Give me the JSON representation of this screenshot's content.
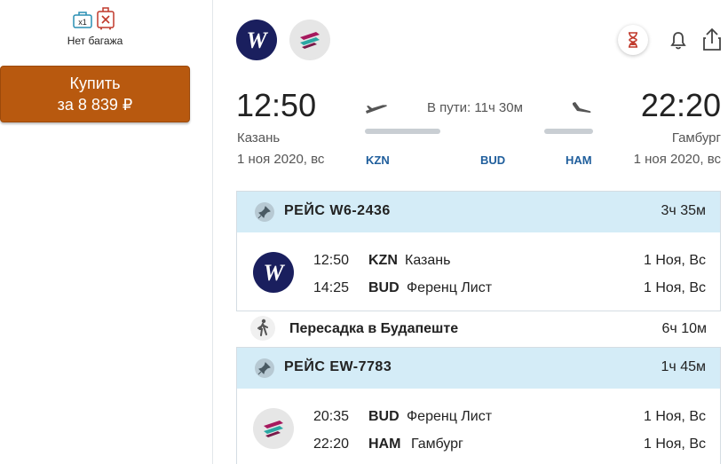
{
  "left": {
    "handbag_badge": "x1",
    "baggage_label": "Нет багажа",
    "buy_button": {
      "line1": "Купить",
      "line2": "за 8 839 ₽"
    }
  },
  "summary": {
    "departure": {
      "time": "12:50",
      "city": "Казань",
      "date": "1 ноя 2020, вс",
      "code": "KZN"
    },
    "arrival": {
      "time": "22:20",
      "city": "Гамбург",
      "date": "1 ноя 2020, вс",
      "code": "HAM"
    },
    "transit_code": "BUD",
    "duration": "В пути: 11ч 30м"
  },
  "segments": [
    {
      "flight": "РЕЙС W6-2436",
      "duration": "3ч 35м",
      "logo": "wizzair-logo",
      "rows": [
        {
          "time": "12:50",
          "code": "KZN",
          "city": "Казань",
          "date": "1 Ноя, Вс"
        },
        {
          "time": "14:25",
          "code": "BUD",
          "city": "Ференц Лист",
          "date": "1 Ноя, Вс"
        }
      ]
    },
    {
      "flight": "РЕЙС EW-7783",
      "duration": "1ч 45м",
      "logo": "eurowings-logo",
      "rows": [
        {
          "time": "20:35",
          "code": "BUD",
          "city": "Ференц Лист",
          "date": "1 Ноя, Вс"
        },
        {
          "time": "22:20",
          "code": "HAM",
          "city": "Гамбург",
          "date": "1 Ноя, Вс"
        }
      ]
    }
  ],
  "transfer": {
    "label": "Пересадка в Будапеште",
    "duration": "6ч 10м"
  },
  "colors": {
    "buy_button": "#b8590f",
    "segment_header": "#d4ecf7",
    "airport_code": "#1f5e9c",
    "wizz_bg": "#1a1f5e"
  }
}
